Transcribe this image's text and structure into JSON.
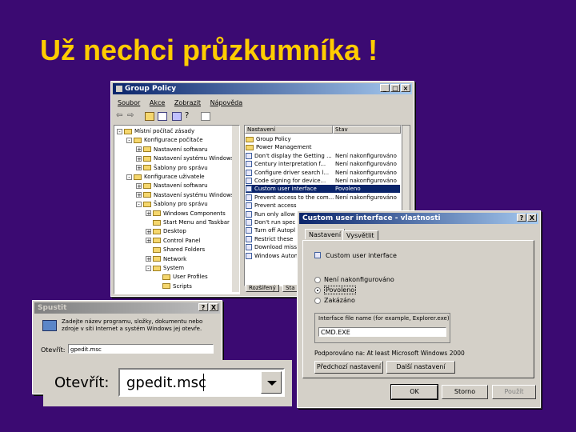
{
  "slide": {
    "title": "Už nechci průzkumníka !"
  },
  "gp": {
    "title": "Group Policy",
    "menu": [
      "Soubor",
      "Akce",
      "Zobrazit",
      "Nápověda"
    ],
    "toolbar_icons": [
      "back-arrow-icon",
      "forward-arrow-icon",
      "up-folder-icon",
      "properties-icon",
      "export-icon",
      "help-icon",
      "view-icon"
    ],
    "tree": [
      {
        "label": "Místní počítač zásady",
        "level": 0,
        "expander": "-"
      },
      {
        "label": "Konfigurace počítače",
        "level": 1,
        "expander": "-"
      },
      {
        "label": "Nastavení softwaru",
        "level": 2,
        "expander": "+"
      },
      {
        "label": "Nastavení systému Windows",
        "level": 2,
        "expander": "+"
      },
      {
        "label": "Šablony pro správu",
        "level": 2,
        "expander": "+"
      },
      {
        "label": "Konfigurace uživatele",
        "level": 1,
        "expander": "-"
      },
      {
        "label": "Nastavení softwaru",
        "level": 2,
        "expander": "+"
      },
      {
        "label": "Nastavení systému Windows",
        "level": 2,
        "expander": "+"
      },
      {
        "label": "Šablony pro správu",
        "level": 2,
        "expander": "-"
      },
      {
        "label": "Windows Components",
        "level": 3,
        "expander": "+"
      },
      {
        "label": "Start Menu and Taskbar",
        "level": 3,
        "expander": ""
      },
      {
        "label": "Desktop",
        "level": 3,
        "expander": "+"
      },
      {
        "label": "Control Panel",
        "level": 3,
        "expander": "+"
      },
      {
        "label": "Shared Folders",
        "level": 3,
        "expander": ""
      },
      {
        "label": "Network",
        "level": 3,
        "expander": "+"
      },
      {
        "label": "System",
        "level": 3,
        "expander": "-"
      },
      {
        "label": "User Profiles",
        "level": 4,
        "expander": ""
      },
      {
        "label": "Scripts",
        "level": 4,
        "expander": ""
      }
    ],
    "list_headers": [
      "Nastavení",
      "Stav"
    ],
    "list_rows": [
      {
        "name": "Group Policy",
        "state": "",
        "folder": true
      },
      {
        "name": "Power Management",
        "state": "",
        "folder": true
      },
      {
        "name": "Don't display the Getting ...",
        "state": "Není nakonfigurováno"
      },
      {
        "name": "Century interpretation f...",
        "state": "Není nakonfigurováno"
      },
      {
        "name": "Configure driver search l...",
        "state": "Není nakonfigurováno"
      },
      {
        "name": "Code signing for device...",
        "state": "Není nakonfigurováno"
      },
      {
        "name": "Custom user interface",
        "state": "Povoleno",
        "selected": true
      },
      {
        "name": "Prevent access to the com...",
        "state": "Není nakonfigurováno"
      },
      {
        "name": "Prevent access",
        "state": ""
      },
      {
        "name": "Run only allow",
        "state": ""
      },
      {
        "name": "Don't run spec",
        "state": ""
      },
      {
        "name": "Turn off Autopl",
        "state": ""
      },
      {
        "name": "Restrict these",
        "state": ""
      },
      {
        "name": "Download miss",
        "state": ""
      },
      {
        "name": "Windows Autom",
        "state": ""
      }
    ],
    "bottom_tabs": [
      "Rozšířený",
      "Sta"
    ]
  },
  "props": {
    "title": "Custom user interface - vlastnosti",
    "title_buttons": [
      "?",
      "X"
    ],
    "tabs": [
      "Nastavení",
      "Vysvětlit"
    ],
    "policy_name": "Custom user interface",
    "options": [
      {
        "label": "Není nakonfigurováno",
        "checked": false
      },
      {
        "label": "Povoleno",
        "checked": true
      },
      {
        "label": "Zakázáno",
        "checked": false
      }
    ],
    "field_label": "Interface file name (for example, Explorer.exe)",
    "field_value": "CMD.EXE",
    "supported": "Podporováno na:  At least Microsoft Windows 2000",
    "prev_button": "Předchozí nastavení",
    "next_button": "Další nastavení",
    "ok": "OK",
    "cancel": "Storno",
    "apply": "Použít"
  },
  "run": {
    "title": "Spustit",
    "title_buttons": [
      "?",
      "X"
    ],
    "description": "Zadejte název programu, složky, dokumentu nebo zdroje v síti Internet a systém Windows jej otevře.",
    "open_label": "Otevřít:",
    "open_value": "gpedit.msc"
  },
  "zoom": {
    "open_label": "Otevřít:",
    "open_value": "gpedit.msc"
  }
}
